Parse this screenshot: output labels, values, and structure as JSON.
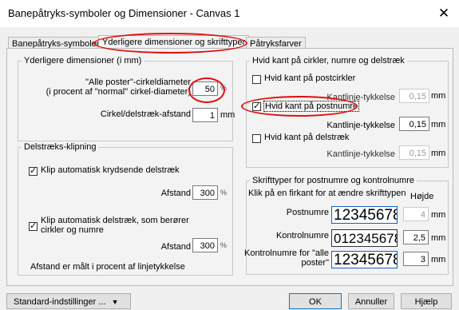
{
  "window": {
    "title": "Banepåtryks-symboler og Dimensioner - Canvas 1",
    "close": "✕"
  },
  "tabs": [
    "Banepåtryks-symboler",
    "Yderligere dimensioner og skrifttyper",
    "Påtryksfarver"
  ],
  "dims": {
    "legend": "Yderligere dimensioner (i mm)",
    "diam_label_1": "\"Alle poster\"-cirkeldiameter",
    "diam_label_2": "(i procent af \"normal\" cirkel-diameter)",
    "diam_value": "50",
    "diam_unit": "%",
    "dist_label": "Cirkel/delstræk-afstand",
    "dist_value": "1",
    "dist_unit": "mm"
  },
  "clip": {
    "legend": "Delstræks-klipning",
    "cb1_label": "Klip automatisk krydsende delstræk",
    "cb1_checked": true,
    "dist1_label": "Afstand",
    "dist1_value": "300",
    "dist1_unit": "%",
    "cb2_label": "Klip automatisk delstræk, som berører cirkler og numre",
    "cb2_checked": true,
    "dist2_label": "Afstand",
    "dist2_value": "300",
    "dist2_unit": "%",
    "note": "Afstand er målt i procent af linjetykkelse"
  },
  "white": {
    "legend": "Hvid kant på cirkler, numre og delstræk",
    "cb1_label": "Hvid kant på postcirkler",
    "cb1_checked": false,
    "w1_label": "Kantlinje-tykkelse",
    "w1_value": "0,15",
    "w1_unit": "mm",
    "cb2_label": "Hvid kant på postnumre",
    "cb2_checked": true,
    "w2_label": "Kantlinje-tykkelse",
    "w2_value": "0,15",
    "w2_unit": "mm",
    "cb3_label": "Hvid kant på delstræk",
    "cb3_checked": false,
    "w3_label": "Kantlinje-tykkelse",
    "w3_value": "0,15",
    "w3_unit": "mm"
  },
  "fonts": {
    "legend": "Skrifttyper for postnumre og kontrolnumre",
    "hint": "Klik på en firkant for at ændre skrifttypen",
    "height_header": "Højde",
    "row1_label": "Postnumre",
    "row1_sample": "12345678",
    "row1_value": "4",
    "row1_unit": "mm",
    "row2_label": "Kontrolnumre",
    "row2_sample": "0123456789",
    "row2_value": "2,5",
    "row2_unit": "mm",
    "row3_label_1": "Kontrolnumre for \"alle",
    "row3_label_2": "poster\"",
    "row3_sample": "12345678",
    "row3_value": "3",
    "row3_unit": "mm"
  },
  "footer": {
    "defaults_label": "Standard-indstillinger ...",
    "defaults_arrow": "▼",
    "ok": "OK",
    "cancel": "Annuller",
    "help": "Hjælp"
  },
  "colors": {
    "highlight_ring": "#e01010",
    "accent": "#0078d7"
  }
}
